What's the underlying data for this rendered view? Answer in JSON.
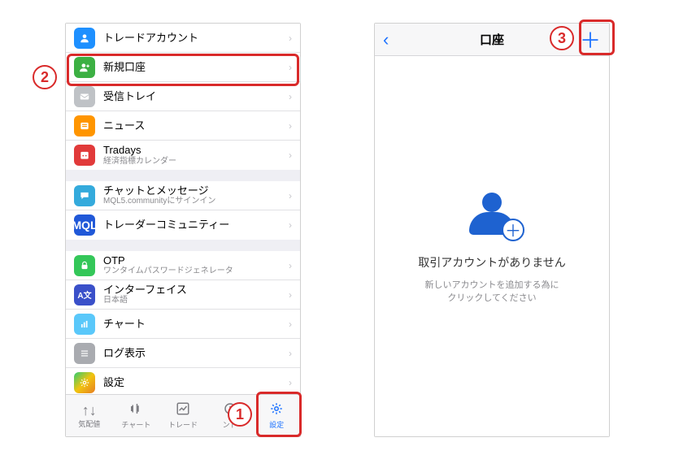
{
  "callouts": {
    "c1": "1",
    "c2": "2",
    "c3": "3"
  },
  "left": {
    "groups": [
      {
        "rows": [
          {
            "label": "トレードアカウント"
          },
          {
            "label": "新規口座"
          },
          {
            "label": "受信トレイ"
          },
          {
            "label": "ニュース"
          },
          {
            "label": "Tradays",
            "sub": "経済指標カレンダー"
          }
        ]
      },
      {
        "rows": [
          {
            "label": "チャットとメッセージ",
            "sub": "MQL5.communityにサインイン"
          },
          {
            "label": "トレーダーコミュニティー"
          }
        ]
      },
      {
        "rows": [
          {
            "label": "OTP",
            "sub": "ワンタイムパスワードジェネレータ"
          },
          {
            "label": "インターフェイス",
            "sub": "日本語"
          },
          {
            "label": "チャート"
          },
          {
            "label": "ログ表示"
          },
          {
            "label": "設定"
          }
        ]
      }
    ],
    "tabs": [
      {
        "label": "気配値"
      },
      {
        "label": "チャート"
      },
      {
        "label": "トレード"
      },
      {
        "label": "ンド"
      },
      {
        "label": "設定"
      }
    ]
  },
  "right": {
    "title": "口座",
    "empty_title": "取引アカウントがありません",
    "empty_sub": "新しいアカウントを追加する為に\nクリックしてください"
  }
}
